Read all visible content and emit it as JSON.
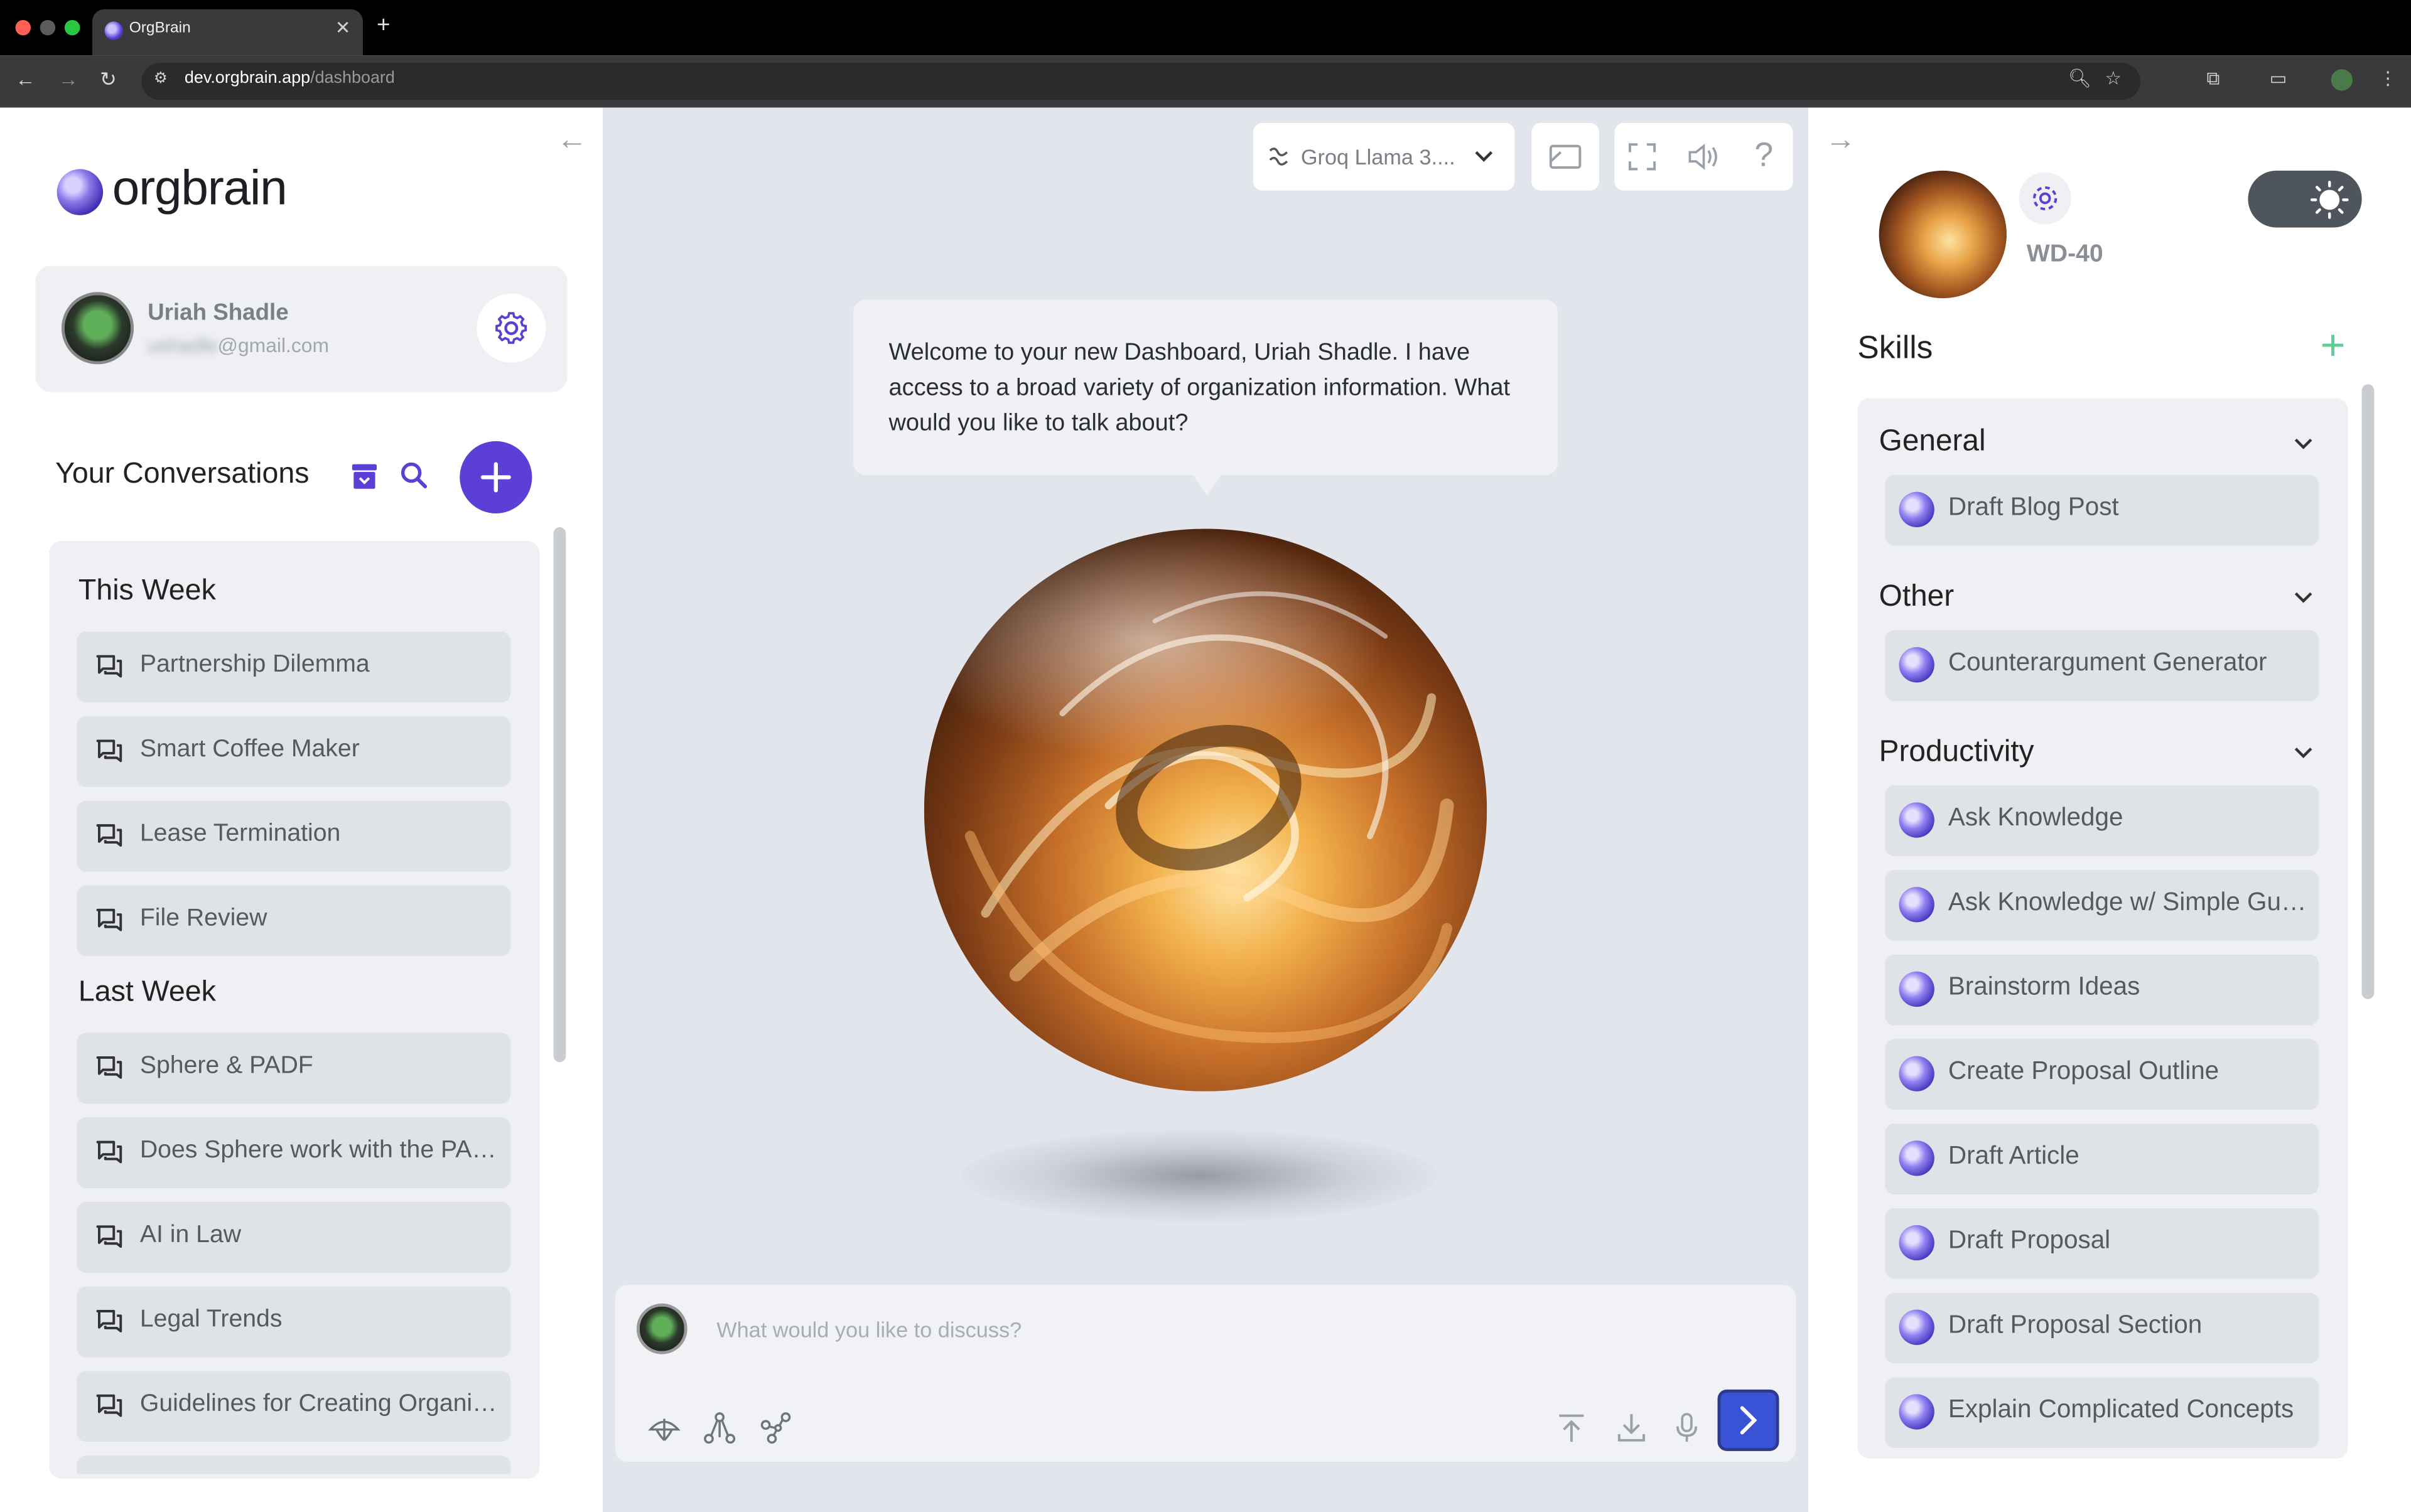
{
  "browser": {
    "tab_title": "OrgBrain",
    "url_host": "dev.orgbrain.app",
    "url_path": "/dashboard",
    "colors": {
      "close": "#ff5f57",
      "minimize": "#febc2e",
      "maximize": "#28c840"
    }
  },
  "sidebar": {
    "logo_text": "orgbrain",
    "user": {
      "name": "Uriah Shadle",
      "email_hidden": "ushadle",
      "email_domain": "@gmail.com"
    },
    "conversations_title": "Your Conversations",
    "groups": [
      {
        "title": "This Week",
        "items": [
          "Partnership Dilemma",
          "Smart Coffee Maker",
          "Lease Termination",
          "File Review"
        ]
      },
      {
        "title": "Last Week",
        "items": [
          "Sphere & PADF",
          "Does Sphere work with the PADF?",
          "AI in Law",
          "Legal Trends",
          "Guidelines for Creating Organizations"
        ]
      }
    ]
  },
  "main": {
    "model_label": "Groq Llama 3....",
    "welcome_message": "Welcome to your new Dashboard, Uriah Shadle. I have access to a broad variety of organization information. What would you like to talk about?",
    "composer_placeholder": "What would you like to discuss?",
    "accent_color": "#3a52d6"
  },
  "agent": {
    "name": "WD-40",
    "skills_title": "Skills",
    "categories": [
      {
        "title": "General",
        "skills": [
          "Draft Blog Post"
        ]
      },
      {
        "title": "Other",
        "skills": [
          "Counterargument Generator"
        ]
      },
      {
        "title": "Productivity",
        "skills": [
          "Ask Knowledge",
          "Ask Knowledge w/ Simple Guardrails",
          "Brainstorm Ideas",
          "Create Proposal Outline",
          "Draft Article",
          "Draft Proposal",
          "Draft Proposal Section",
          "Explain Complicated Concepts"
        ]
      }
    ]
  },
  "icons": [
    "arrow-left-icon",
    "gear-icon",
    "archive-icon",
    "search-icon",
    "plus-icon",
    "chat-icon",
    "chevron-down-icon",
    "sun-icon",
    "fullscreen-icon",
    "volume-icon",
    "help-icon",
    "upload-icon",
    "download-icon",
    "microphone-icon",
    "send-icon"
  ]
}
